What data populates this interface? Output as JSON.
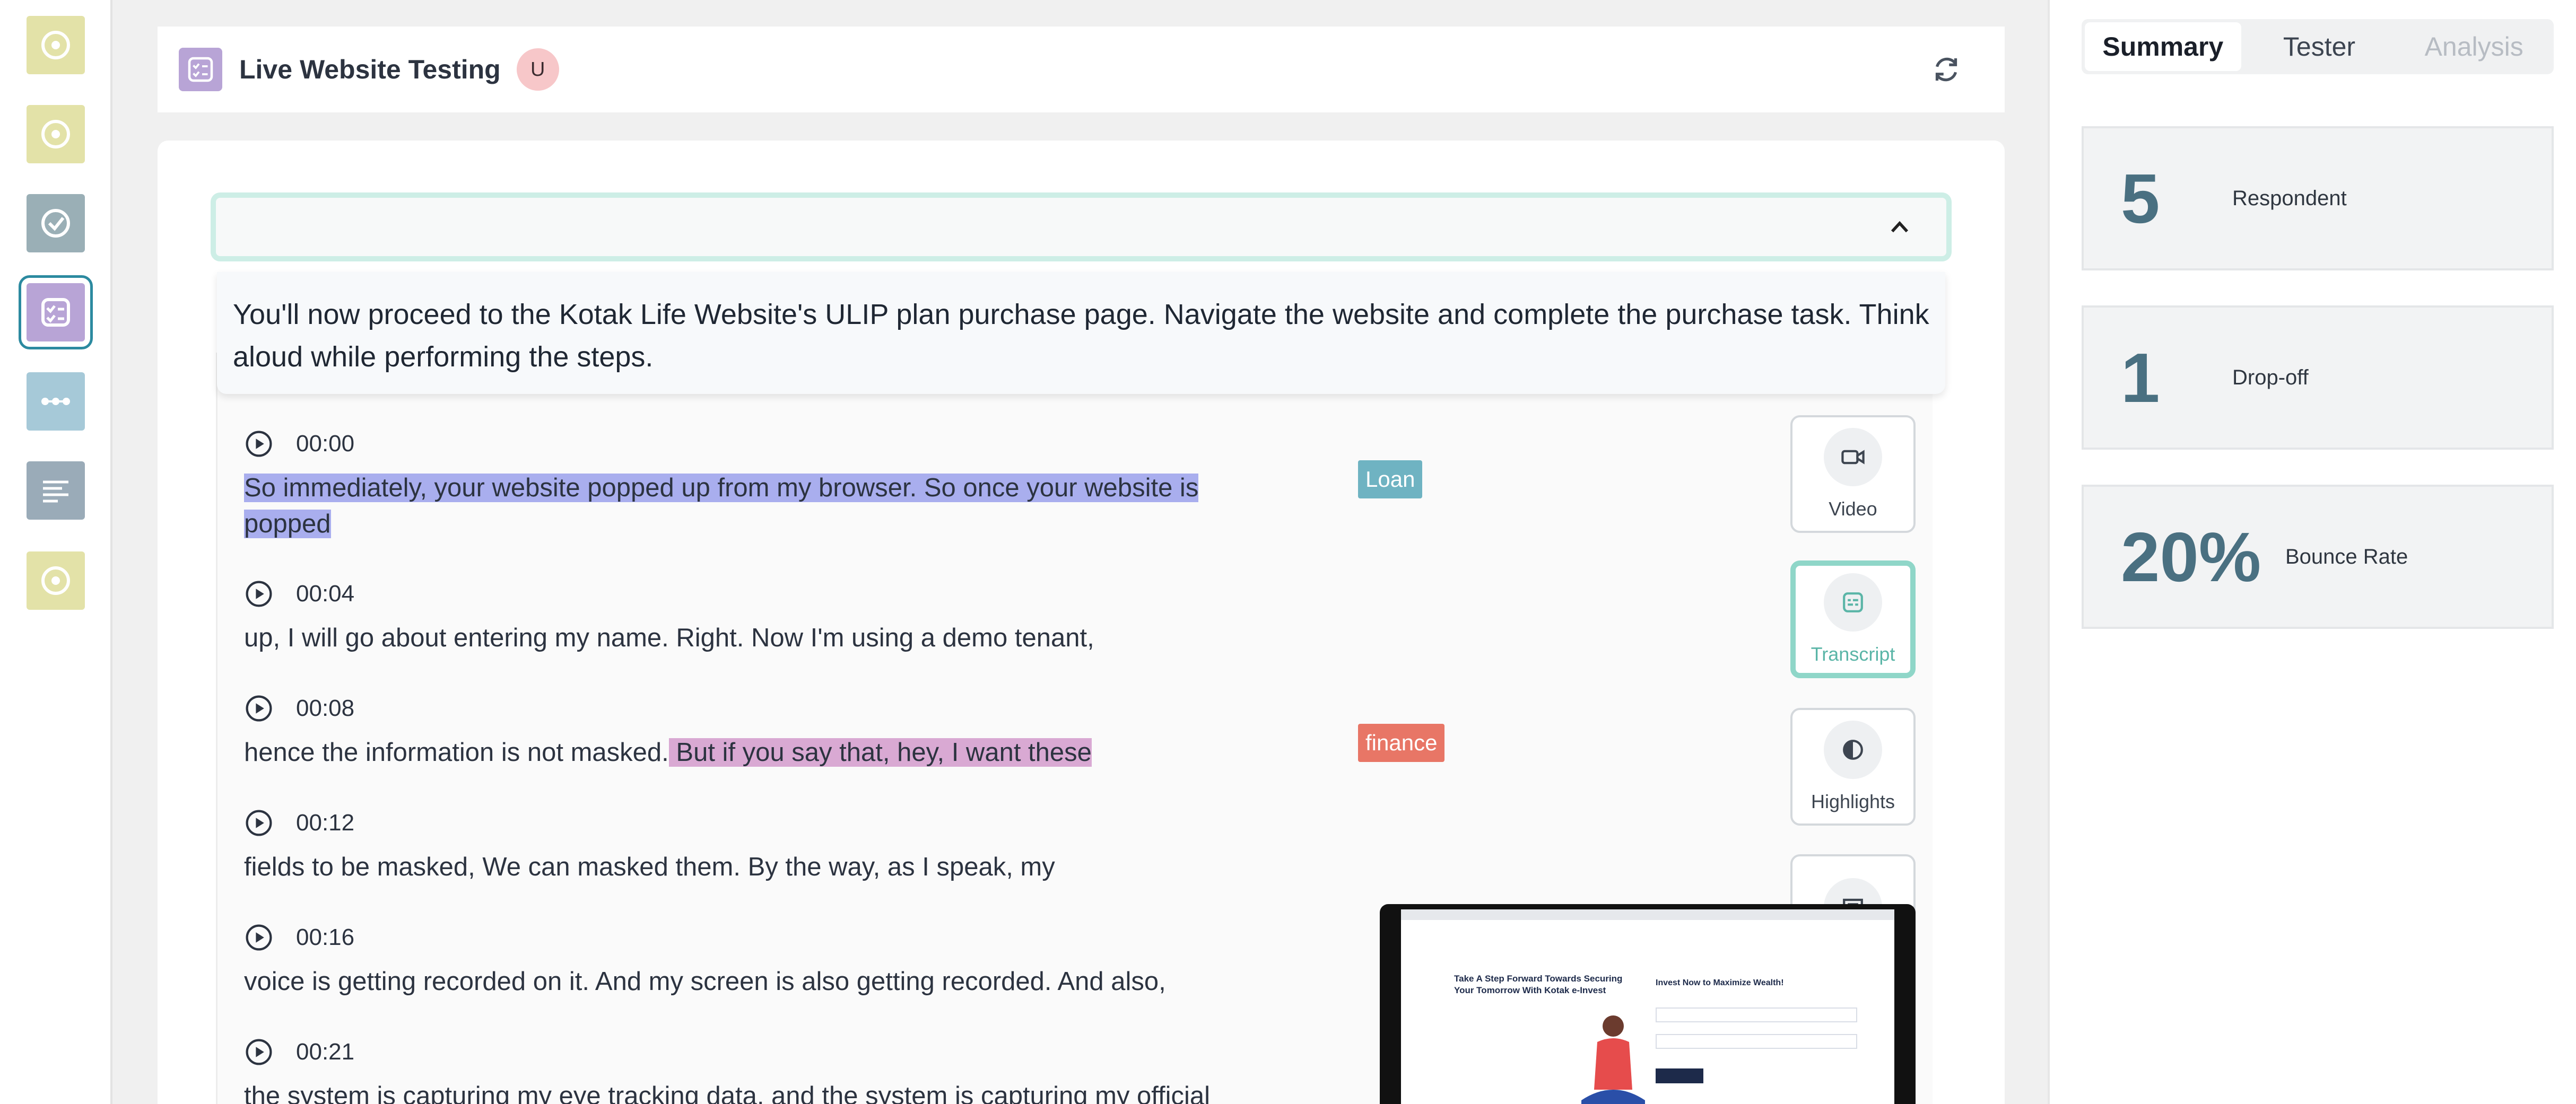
{
  "sidebar": {
    "items": [
      {
        "icon": "target-icon",
        "color": "#e3e2a8"
      },
      {
        "icon": "target-icon",
        "color": "#e3e2a8"
      },
      {
        "icon": "check-circle-icon",
        "color": "#9aafb6"
      },
      {
        "icon": "checklist-icon",
        "color": "#b8a4d6",
        "active": true
      },
      {
        "icon": "flow-icon",
        "color": "#a6c9d8"
      },
      {
        "icon": "text-lines-icon",
        "color": "#9aabb8"
      },
      {
        "icon": "target-icon",
        "color": "#e3e2a8"
      }
    ]
  },
  "header": {
    "title": "Live Website Testing",
    "avatar_initial": "U"
  },
  "task": {
    "description": "You'll now proceed to the Kotak Life Website's ULIP plan purchase page. Navigate the website and complete the purchase task. Think aloud while performing the steps."
  },
  "transcript": [
    {
      "time": "00:00",
      "segments": [
        {
          "text": "So immediately, your website popped up from my browser. So once your website is popped",
          "highlight": "blue"
        }
      ]
    },
    {
      "time": "00:04",
      "segments": [
        {
          "text": "up, I will go about entering my name. Right. Now I'm using a demo tenant,",
          "highlight": ""
        }
      ]
    },
    {
      "time": "00:08",
      "segments": [
        {
          "text": "hence the information is not masked.",
          "highlight": ""
        },
        {
          "text": " But if you say that, hey, I want these",
          "highlight": "pink"
        }
      ]
    },
    {
      "time": "00:12",
      "segments": [
        {
          "text": "fields to be masked, We can masked them. By the way, as I speak, my",
          "highlight": ""
        }
      ]
    },
    {
      "time": "00:16",
      "segments": [
        {
          "text": "voice is getting recorded on it. And my screen is also getting recorded. And also,",
          "highlight": ""
        }
      ]
    },
    {
      "time": "00:21",
      "segments": [
        {
          "text": "the system is capturing my eye tracking data, and the system is capturing my official",
          "highlight": ""
        }
      ]
    }
  ],
  "tags": [
    {
      "label": "Loan",
      "color": "#6fb3c2"
    },
    {
      "label": "finance",
      "color": "#e87666"
    }
  ],
  "side_buttons": [
    {
      "label": "Video",
      "icon": "video-icon"
    },
    {
      "label": "Transcript",
      "icon": "transcript-icon",
      "active": true
    },
    {
      "label": "Highlights",
      "icon": "highlight-icon"
    },
    {
      "label": "",
      "icon": "comment-icon"
    }
  ],
  "video_preview": {
    "headline": "Take A Step Forward Towards Securing Your Tomorrow With Kotak e-Invest",
    "form_title": "Invest Now to Maximize Wealth!"
  },
  "summary_panel": {
    "tabs": [
      "Summary",
      "Tester",
      "Analysis"
    ],
    "active_tab": "Summary",
    "stats": [
      {
        "value": "5",
        "label": "Respondent"
      },
      {
        "value": "1",
        "label": "Drop-off"
      },
      {
        "value": "20%",
        "label": "Bounce Rate"
      }
    ]
  }
}
